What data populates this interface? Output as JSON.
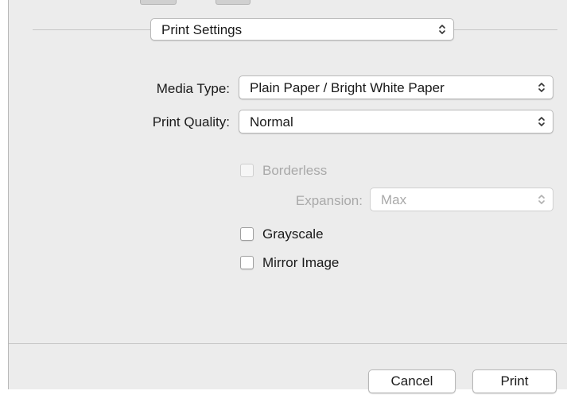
{
  "preset_popup": {
    "value": "Print Settings"
  },
  "settings": {
    "media_type": {
      "label": "Media Type:",
      "value": "Plain Paper / Bright White Paper"
    },
    "print_quality": {
      "label": "Print Quality:",
      "value": "Normal"
    }
  },
  "options": {
    "borderless": {
      "label": "Borderless",
      "checked": false,
      "enabled": false
    },
    "expansion": {
      "label": "Expansion:",
      "value": "Max",
      "enabled": false
    },
    "grayscale": {
      "label": "Grayscale",
      "checked": false,
      "enabled": true
    },
    "mirror_image": {
      "label": "Mirror Image",
      "checked": false,
      "enabled": true
    }
  },
  "footer": {
    "cancel_label": "Cancel",
    "print_label": "Print"
  },
  "icons": {
    "popup_arrows": "up-down-chevron-icon"
  },
  "colors": {
    "panel_bg": "#ececec",
    "disabled_text": "#a9a9a9"
  }
}
